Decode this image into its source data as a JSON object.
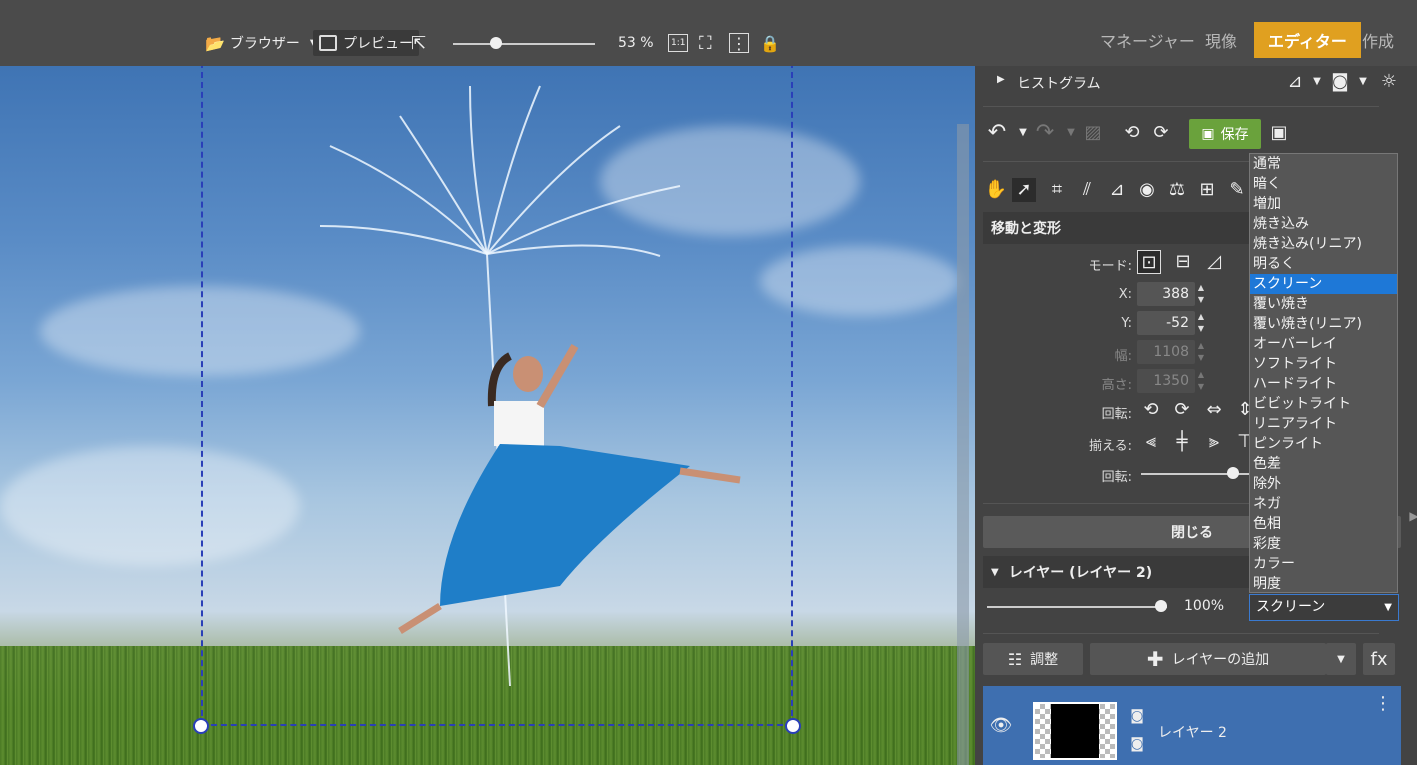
{
  "toolbar": {
    "browser_label": "ブラウザー",
    "preview_label": "プレビュー",
    "zoom_value": "53 %",
    "zoom_level": 0.53,
    "one_to_one": "1:1"
  },
  "modes": {
    "manager": "マネージャー",
    "develop": "現像",
    "editor": "エディター",
    "create": "作成"
  },
  "panel": {
    "histogram_title": "ヒストグラム",
    "save_label": "保存",
    "move_section_title": "移動と変形",
    "mode_label": "モード:",
    "x_label": "X:",
    "x_value": "388",
    "y_label": "Y:",
    "y_value": "-52",
    "width_label": "幅:",
    "width_value": "1108",
    "height_label": "高さ:",
    "height_value": "1350",
    "rotate_label": "回転:",
    "align_label": "揃える:",
    "rotate2_label": "回転:",
    "close_label": "閉じる",
    "layer_section_title": "レイヤー (レイヤー 2)",
    "opacity_value": "100%",
    "blend_mode_value": "スクリーン",
    "adjust_label": "調整",
    "add_layer_label": "レイヤーの追加",
    "fx_label": "fx",
    "layer_name": "レイヤー 2"
  },
  "blend_modes": [
    "通常",
    "暗く",
    "増加",
    "焼き込み",
    "焼き込み(リニア)",
    "明るく",
    "スクリーン",
    "覆い焼き",
    "覆い焼き(リニア)",
    "オーバーレイ",
    "ソフトライト",
    "ハードライト",
    "ビビットライト",
    "リニアライト",
    "ピンライト",
    "色差",
    "除外",
    "ネガ",
    "色相",
    "彩度",
    "カラー",
    "明度"
  ],
  "selected_blend_index": 6,
  "colors": {
    "accent": "#e0a020",
    "save_green": "#6aa23c",
    "selection": "#1e78d7",
    "layer_row": "#3e6fb0"
  }
}
